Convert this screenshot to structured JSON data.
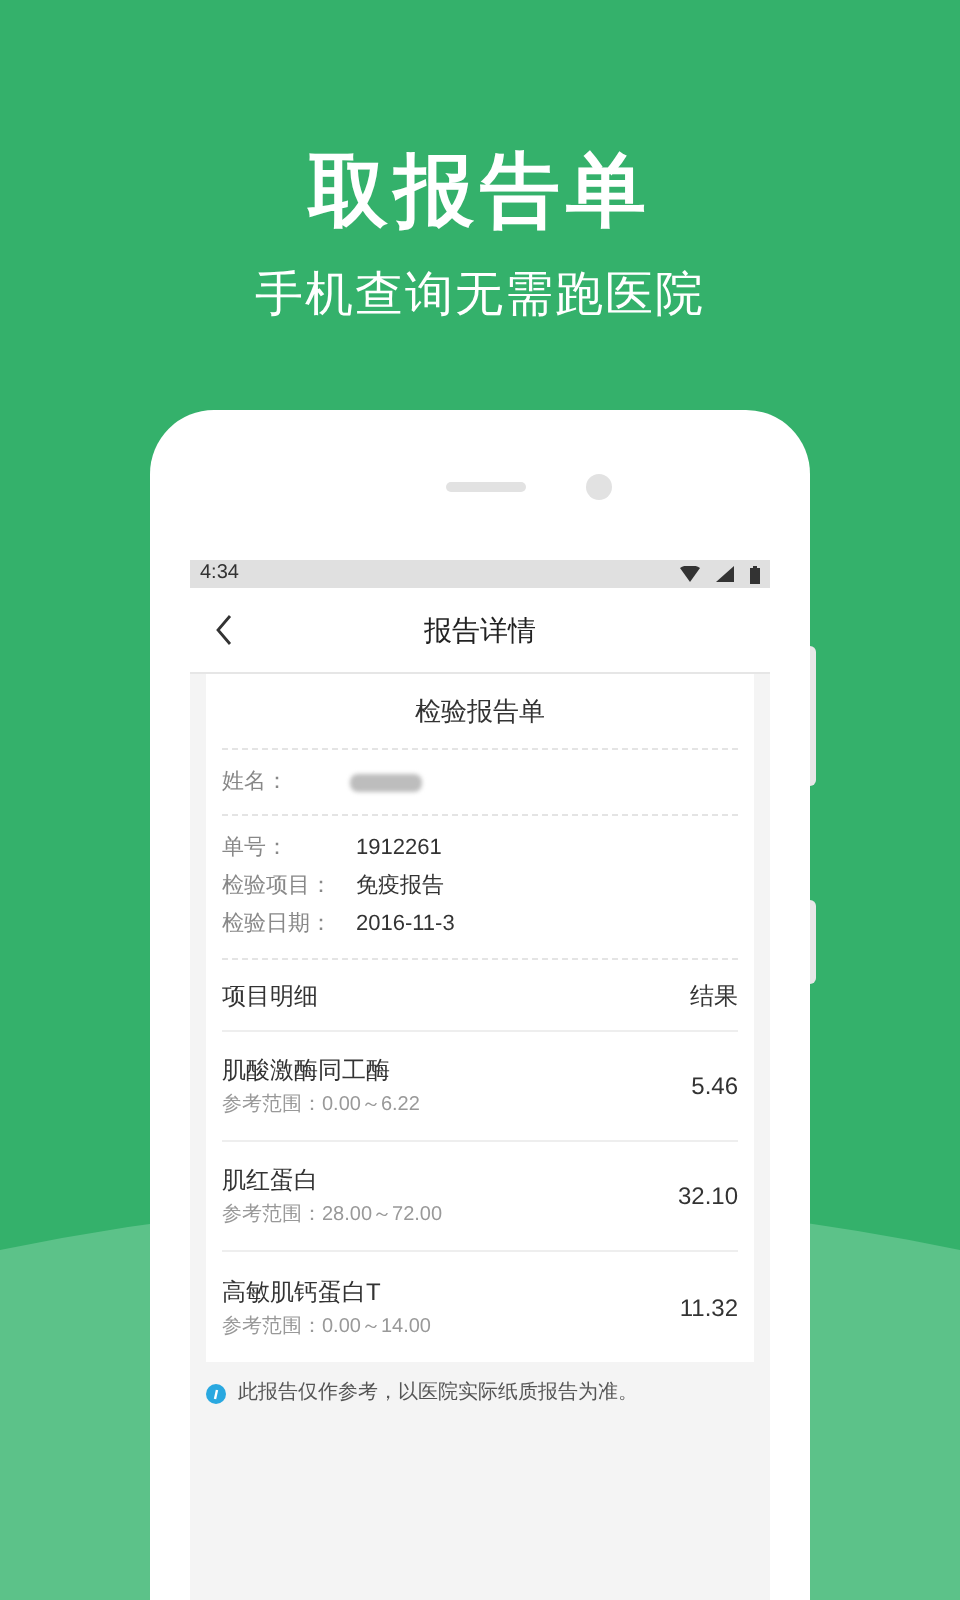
{
  "headline": "取报告单",
  "subheadline": "手机查询无需跑医院",
  "status_bar": {
    "time": "4:34"
  },
  "nav": {
    "title": "报告详情"
  },
  "report": {
    "title": "检验报告单",
    "name_label": "姓名：",
    "info": [
      {
        "label": "单号：",
        "value": "1912261"
      },
      {
        "label": "检验项目：",
        "value": "免疫报告"
      },
      {
        "label": "检验日期：",
        "value": "2016-11-3"
      }
    ],
    "columns": [
      "项目明细",
      "结果"
    ],
    "items": [
      {
        "name": "肌酸激酶同工酶",
        "range": "参考范围：0.00～6.22",
        "result": "5.46"
      },
      {
        "name": "肌红蛋白",
        "range": "参考范围：28.00～72.00",
        "result": "32.10"
      },
      {
        "name": "高敏肌钙蛋白T",
        "range": "参考范围：0.00～14.00",
        "result": "11.32"
      }
    ]
  },
  "note": "此报告仅作参考，以医院实际纸质报告为准。"
}
